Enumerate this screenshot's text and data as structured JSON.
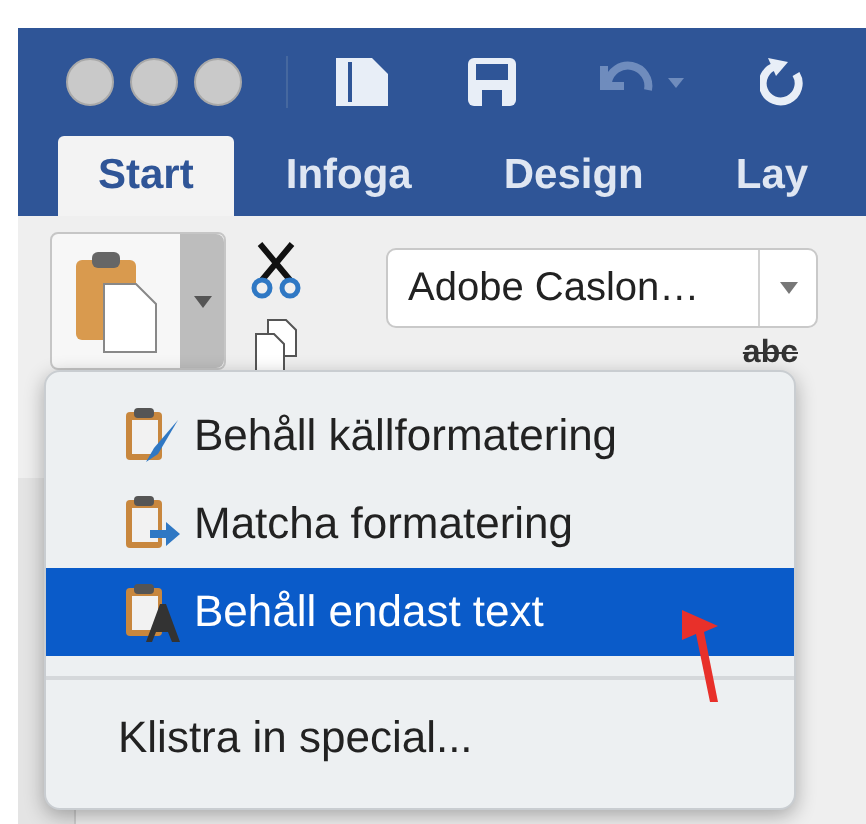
{
  "quick_access": {
    "undo_disabled": true
  },
  "tabs": [
    {
      "label": "Start",
      "selected": true
    },
    {
      "label": "Infoga",
      "selected": false
    },
    {
      "label": "Design",
      "selected": false
    },
    {
      "label": "Lay",
      "selected": false
    }
  ],
  "font_field": {
    "value": "Adobe Caslon…"
  },
  "strikethrough_label": "abc",
  "paste_menu": {
    "items": [
      {
        "kind": "keep-source",
        "label": "Behåll källformatering",
        "selected": false
      },
      {
        "kind": "match",
        "label": "Matcha formatering",
        "selected": false
      },
      {
        "kind": "text-only",
        "label": "Behåll endast text",
        "selected": true
      },
      {
        "kind": "plain",
        "label": "Klistra in special...",
        "selected": false
      }
    ]
  }
}
